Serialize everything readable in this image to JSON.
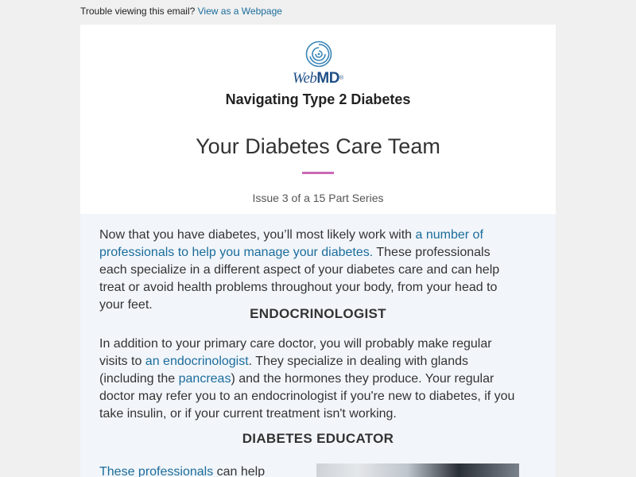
{
  "preheader": {
    "text": "Trouble viewing this email?",
    "link": "View as a Webpage"
  },
  "logo": {
    "web": "Web",
    "md": "MD",
    "mark": "®"
  },
  "header": {
    "newsletter_title": "Navigating Type 2 Diabetes",
    "issue_title": "Your Diabetes Care Team",
    "issue_count": "Issue 3 of a 15 Part Series"
  },
  "colors": {
    "link": "#1b6c9c",
    "accent_divider": "#c969b5",
    "logo_blue": "#1f4f86",
    "content_bg": "#f2f6fa"
  },
  "intro": {
    "text_before": "Now that you have diabetes, you’ll most likely work with ",
    "link": "a number of professionals to help you manage your diabetes.",
    "text_after": " These professionals each specialize in a different aspect of your diabetes care and can help treat or avoid health problems throughout your body, from your head to your feet."
  },
  "endocrinologist": {
    "heading": "ENDOCRINOLOGIST",
    "t1": "In addition to your primary care doctor, you will probably make regular visits to ",
    "link1": "an endocrinologist",
    "t2": ". They specialize in dealing with glands (including the ",
    "link2": "pancreas",
    "t3": ") and the hormones they produce. Your regular doctor may refer you to an endocrinologist if you're new to diabetes, if you take insulin, or if your current treatment isn't working."
  },
  "educator": {
    "heading": "DIABETES EDUCATOR",
    "link": "These professionals",
    "text": " can help"
  }
}
